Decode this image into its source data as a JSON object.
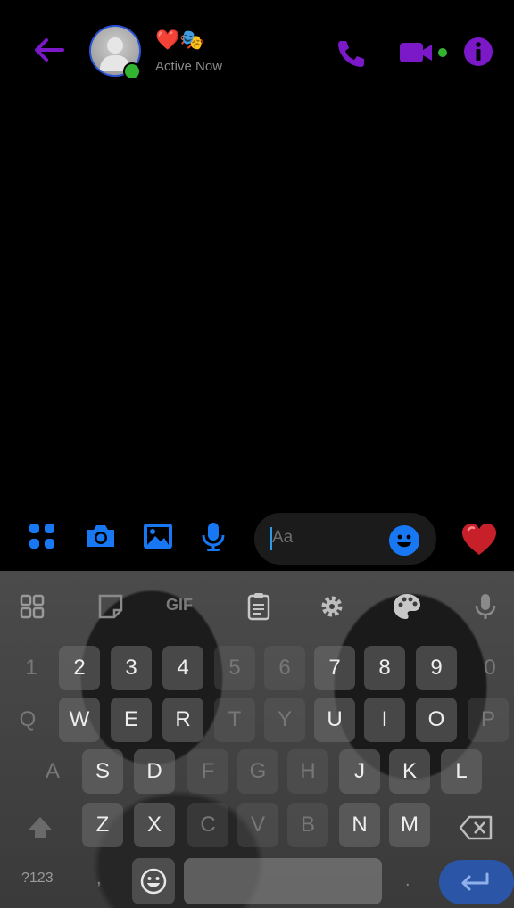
{
  "header": {
    "contact_name_hearts": "❤️",
    "contact_name_mask": "🎭",
    "status": "Active Now"
  },
  "composer": {
    "placeholder": "Aa"
  },
  "keyboard": {
    "number_row": [
      "1",
      "2",
      "3",
      "4",
      "5",
      "6",
      "7",
      "8",
      "9",
      "0"
    ],
    "row_q": [
      "Q",
      "W",
      "E",
      "R",
      "T",
      "Y",
      "U",
      "I",
      "O",
      "P"
    ],
    "row_a": [
      "A",
      "S",
      "D",
      "F",
      "G",
      "H",
      "J",
      "K",
      "L"
    ],
    "row_z": [
      "Z",
      "X",
      "C",
      "V",
      "B",
      "N",
      "M"
    ],
    "symbols_label": "?123",
    "comma": ",",
    "period": ".",
    "toolbar_gif": "GIF"
  },
  "colors": {
    "header_accent": "#7b18c8",
    "composer_accent": "#1877f2",
    "online": "#31b531",
    "enter_key": "#2b56a8"
  }
}
